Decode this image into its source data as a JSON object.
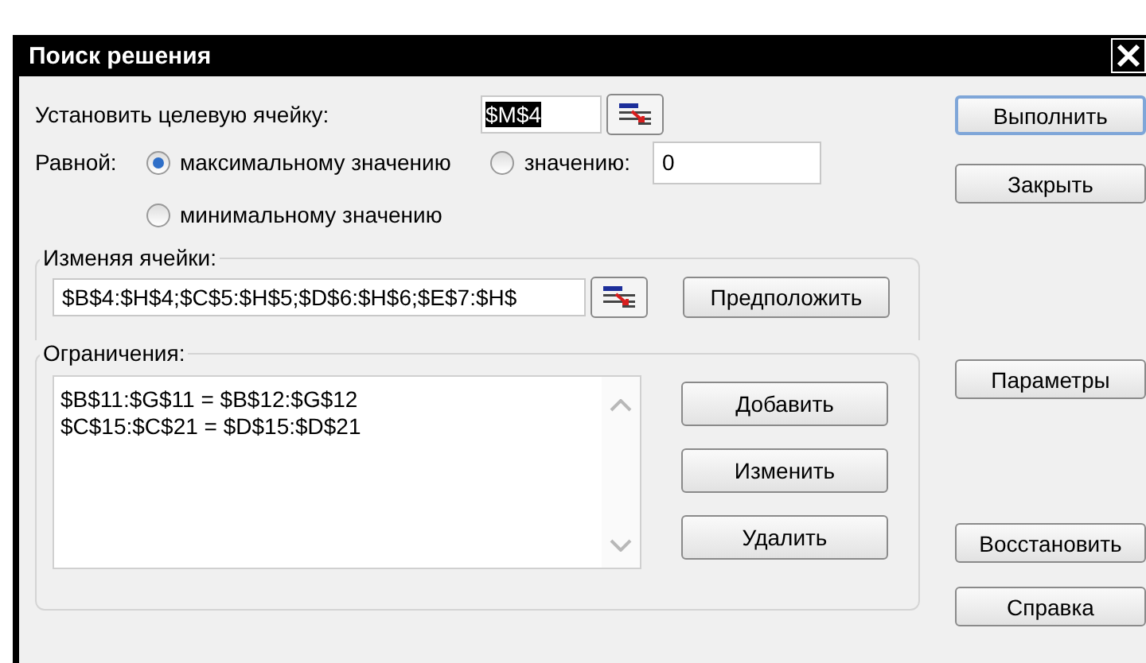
{
  "window": {
    "title": "Поиск решения"
  },
  "target": {
    "label": "Установить целевую ячейку:",
    "value": "$M$4"
  },
  "equal_to": {
    "label": "Равной:",
    "options": [
      {
        "kind": "plain",
        "label": "максимальному значению",
        "selected": true
      },
      {
        "kind": "value",
        "label": "значению:",
        "selected": false,
        "value": "0"
      },
      {
        "kind": "plain",
        "label": "минимальному значению",
        "selected": false
      }
    ]
  },
  "changing_cells": {
    "label": "Изменяя ячейки:",
    "value": "$B$4:$H$4;$C$5:$H$5;$D$6:$H$6;$E$7:$H$",
    "button": "Предположить"
  },
  "constraints": {
    "label": "Ограничения:",
    "items": [
      "$B$11:$G$11 = $B$12:$G$12",
      "$C$15:$C$21 = $D$15:$D$21"
    ],
    "buttons": [
      "Добавить",
      "Изменить",
      "Удалить"
    ]
  },
  "side_buttons": [
    {
      "label": "Выполнить",
      "default": true
    },
    {
      "label": "Закрыть",
      "default": false
    },
    {
      "label": "Параметры",
      "default": false
    },
    {
      "label": "Восстановить",
      "default": false
    },
    {
      "label": "Справка",
      "default": false
    }
  ]
}
